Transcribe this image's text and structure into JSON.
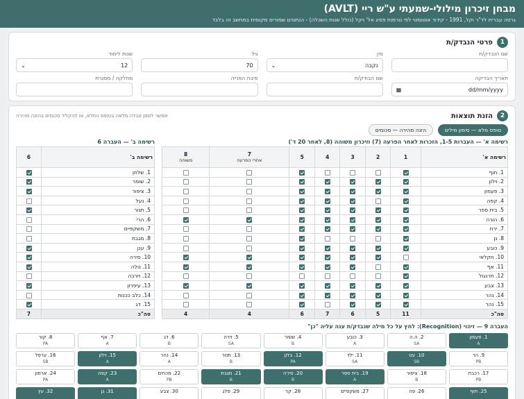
{
  "header": {
    "title": "מבחן זיכרון מילולי-שמעתי ע\"ש ריי (AVLT)",
    "subtitle": "גרסה עברית לד\"ר וקל, 1991 - קידוד אוטומטי לפי נורמות פסיג אל' ויקל (כולל שנות השכלה) - הנתונים שמורים מקומית במחשב זה בלבד"
  },
  "section1": {
    "number": "1",
    "title": "פרטי הנבדק/ת",
    "fields": [
      {
        "label": "שם הנבדק/ת",
        "value": "",
        "kind": "text"
      },
      {
        "label": "מין",
        "value": "נקבה",
        "kind": "select"
      },
      {
        "label": "גיל",
        "value": "70",
        "kind": "text"
      },
      {
        "label": "שנות לימוד",
        "value": "12",
        "kind": "select"
      },
      {
        "label": "תאריך הבדיקה",
        "value": "dd/mm/yyyy",
        "kind": "date"
      },
      {
        "label": "שם הבודק/ת",
        "value": "",
        "kind": "text"
      },
      {
        "label": "סיבת הפנייה",
        "value": "",
        "kind": "text"
      },
      {
        "label": "מחלקה / מסגרת",
        "value": "",
        "kind": "text"
      }
    ]
  },
  "section2": {
    "number": "2",
    "title": "הזנת תוצאות",
    "mode_full": "טופס מלא — סימון מילים",
    "mode_quick": "הזנה מהירה — סכומים",
    "hint": "אפשר לסמן טבלה מלאה בטופס התלא, או להקליד סכומים בהזנה מהירה"
  },
  "listA": {
    "caption": "רשימה א' — העברות 1-5, הזכרות לאחר הפרעה (7) וזיכרון משוהה (8, לאחר 20 ד')",
    "header": "רשימה א'",
    "cols": [
      {
        "num": "1",
        "sub": ""
      },
      {
        "num": "2",
        "sub": ""
      },
      {
        "num": "3",
        "sub": ""
      },
      {
        "num": "4",
        "sub": ""
      },
      {
        "num": "5",
        "sub": ""
      },
      {
        "num": "7",
        "sub": "אחרי הפרעה"
      },
      {
        "num": "8",
        "sub": "משוהה"
      }
    ],
    "rows": [
      {
        "w": "1. תוף",
        "c": [
          1,
          0,
          0,
          0,
          1,
          0,
          0
        ]
      },
      {
        "w": "2. וילון",
        "c": [
          1,
          1,
          1,
          1,
          1,
          0,
          0
        ]
      },
      {
        "w": "3. פעמון",
        "c": [
          1,
          1,
          1,
          1,
          1,
          0,
          0
        ]
      },
      {
        "w": "4. קפה",
        "c": [
          1,
          0,
          1,
          1,
          1,
          0,
          0
        ]
      },
      {
        "w": "5. בית ספר",
        "c": [
          1,
          1,
          1,
          1,
          1,
          0,
          0
        ]
      },
      {
        "w": "6. הורה",
        "c": [
          1,
          1,
          1,
          1,
          1,
          1,
          1
        ]
      },
      {
        "w": "7. ירח",
        "c": [
          1,
          1,
          1,
          1,
          1,
          0,
          0
        ]
      },
      {
        "w": "8. גן",
        "c": [
          1,
          0,
          0,
          0,
          1,
          0,
          0
        ]
      },
      {
        "w": "9. כובע",
        "c": [
          1,
          1,
          1,
          1,
          1,
          0,
          0
        ]
      },
      {
        "w": "10. חקלאי",
        "c": [
          0,
          1,
          1,
          1,
          1,
          1,
          1
        ]
      },
      {
        "w": "11. אף",
        "c": [
          1,
          0,
          1,
          1,
          1,
          1,
          1
        ]
      },
      {
        "w": "12. תרנגול",
        "c": [
          1,
          0,
          0,
          0,
          0,
          0,
          0
        ]
      },
      {
        "w": "13. צבע",
        "c": [
          1,
          1,
          1,
          1,
          1,
          1,
          1
        ]
      },
      {
        "w": "14. נהר",
        "c": [
          1,
          1,
          1,
          1,
          1,
          0,
          0
        ]
      },
      {
        "w": "15. נהר",
        "c": [
          1,
          1,
          1,
          0,
          1,
          0,
          0
        ]
      }
    ],
    "total_label": "סה\"כ",
    "totals": [
      "11",
      "5",
      "6",
      "7",
      "6",
      "4",
      "4"
    ]
  },
  "listB": {
    "caption": "רשימה ב' — העברה 6",
    "header": "רשימה ב'",
    "col": "6",
    "rows": [
      {
        "w": "1. שלחן",
        "c": 1
      },
      {
        "w": "2. שומר",
        "c": 1
      },
      {
        "w": "3. ציפור",
        "c": 1
      },
      {
        "w": "4. נעל",
        "c": 0
      },
      {
        "w": "5. תנור",
        "c": 1
      },
      {
        "w": "6. הרי",
        "c": 0
      },
      {
        "w": "7. משקפיים",
        "c": 0
      },
      {
        "w": "8. מגבת",
        "c": 0
      },
      {
        "w": "9. ענן",
        "c": 1
      },
      {
        "w": "10. סירה",
        "c": 1
      },
      {
        "w": "11. טלה",
        "c": 1
      },
      {
        "w": "12. חרבה",
        "c": 0
      },
      {
        "w": "13. עיפרון",
        "c": 1
      },
      {
        "w": "14. כלב ככנות",
        "c": 0
      },
      {
        "w": "15. דג",
        "c": 1
      }
    ],
    "total_label": "סה\"כ",
    "total": "7"
  },
  "recognition": {
    "caption": "העברה 9 — זיהוי (Recognition): לחץ על כל מילה שנבדק/ת ענה עליה \"כן\"",
    "cells": [
      {
        "w": "1. פעמון",
        "t": "A",
        "on": 1
      },
      {
        "w": "2. ה.ה",
        "t": "SA",
        "on": 0
      },
      {
        "w": "3. כובע",
        "t": "A",
        "on": 0
      },
      {
        "w": "4. שומר",
        "t": "B",
        "on": 0
      },
      {
        "w": "5. זירה",
        "t": "SA",
        "on": 0
      },
      {
        "w": "6. דג",
        "t": "B",
        "on": 0
      },
      {
        "w": "7. אף",
        "t": "A",
        "on": 0
      },
      {
        "w": "8. קור",
        "t": "PA",
        "on": 0
      },
      {
        "w": "9. הר",
        "t": "PB",
        "on": 0
      },
      {
        "w": "10. עט",
        "t": "SB",
        "on": 1
      },
      {
        "w": "11. ילד",
        "t": "SA",
        "on": 0
      },
      {
        "w": "12. בלון",
        "t": "PA",
        "on": 1
      },
      {
        "w": "13. תנור",
        "t": "B",
        "on": 0
      },
      {
        "w": "14. נהר",
        "t": "A",
        "on": 0
      },
      {
        "w": "15. וילון",
        "t": "A",
        "on": 1
      },
      {
        "w": "16. ערפל",
        "t": "SB",
        "on": 0
      },
      {
        "w": "17. רכבת",
        "t": "PB",
        "on": 0
      },
      {
        "w": "18. ציפור",
        "t": "B",
        "on": 0
      },
      {
        "w": "19. בית ספר",
        "t": "A",
        "on": 1
      },
      {
        "w": "20. סירה",
        "t": "B",
        "on": 1
      },
      {
        "w": "21. מגבת",
        "t": "B",
        "on": 1
      },
      {
        "w": "22. מכחים",
        "t": "PB",
        "on": 0
      },
      {
        "w": "23. קפה",
        "t": "A",
        "on": 1
      },
      {
        "w": "24. ארמון",
        "t": "PA",
        "on": 0
      },
      {
        "w": "25. תוף",
        "t": "",
        "on": 1
      },
      {
        "w": "26. פה",
        "t": "",
        "on": 0
      },
      {
        "w": "27. משקפיים",
        "t": "",
        "on": 0
      },
      {
        "w": "28. קר",
        "t": "",
        "on": 0
      },
      {
        "w": "29. פלג",
        "t": "",
        "on": 0
      },
      {
        "w": "30. צבע",
        "t": "",
        "on": 0
      },
      {
        "w": "31. גן",
        "t": "",
        "on": 1
      },
      {
        "w": "32. עץ",
        "t": "",
        "on": 1
      }
    ]
  }
}
